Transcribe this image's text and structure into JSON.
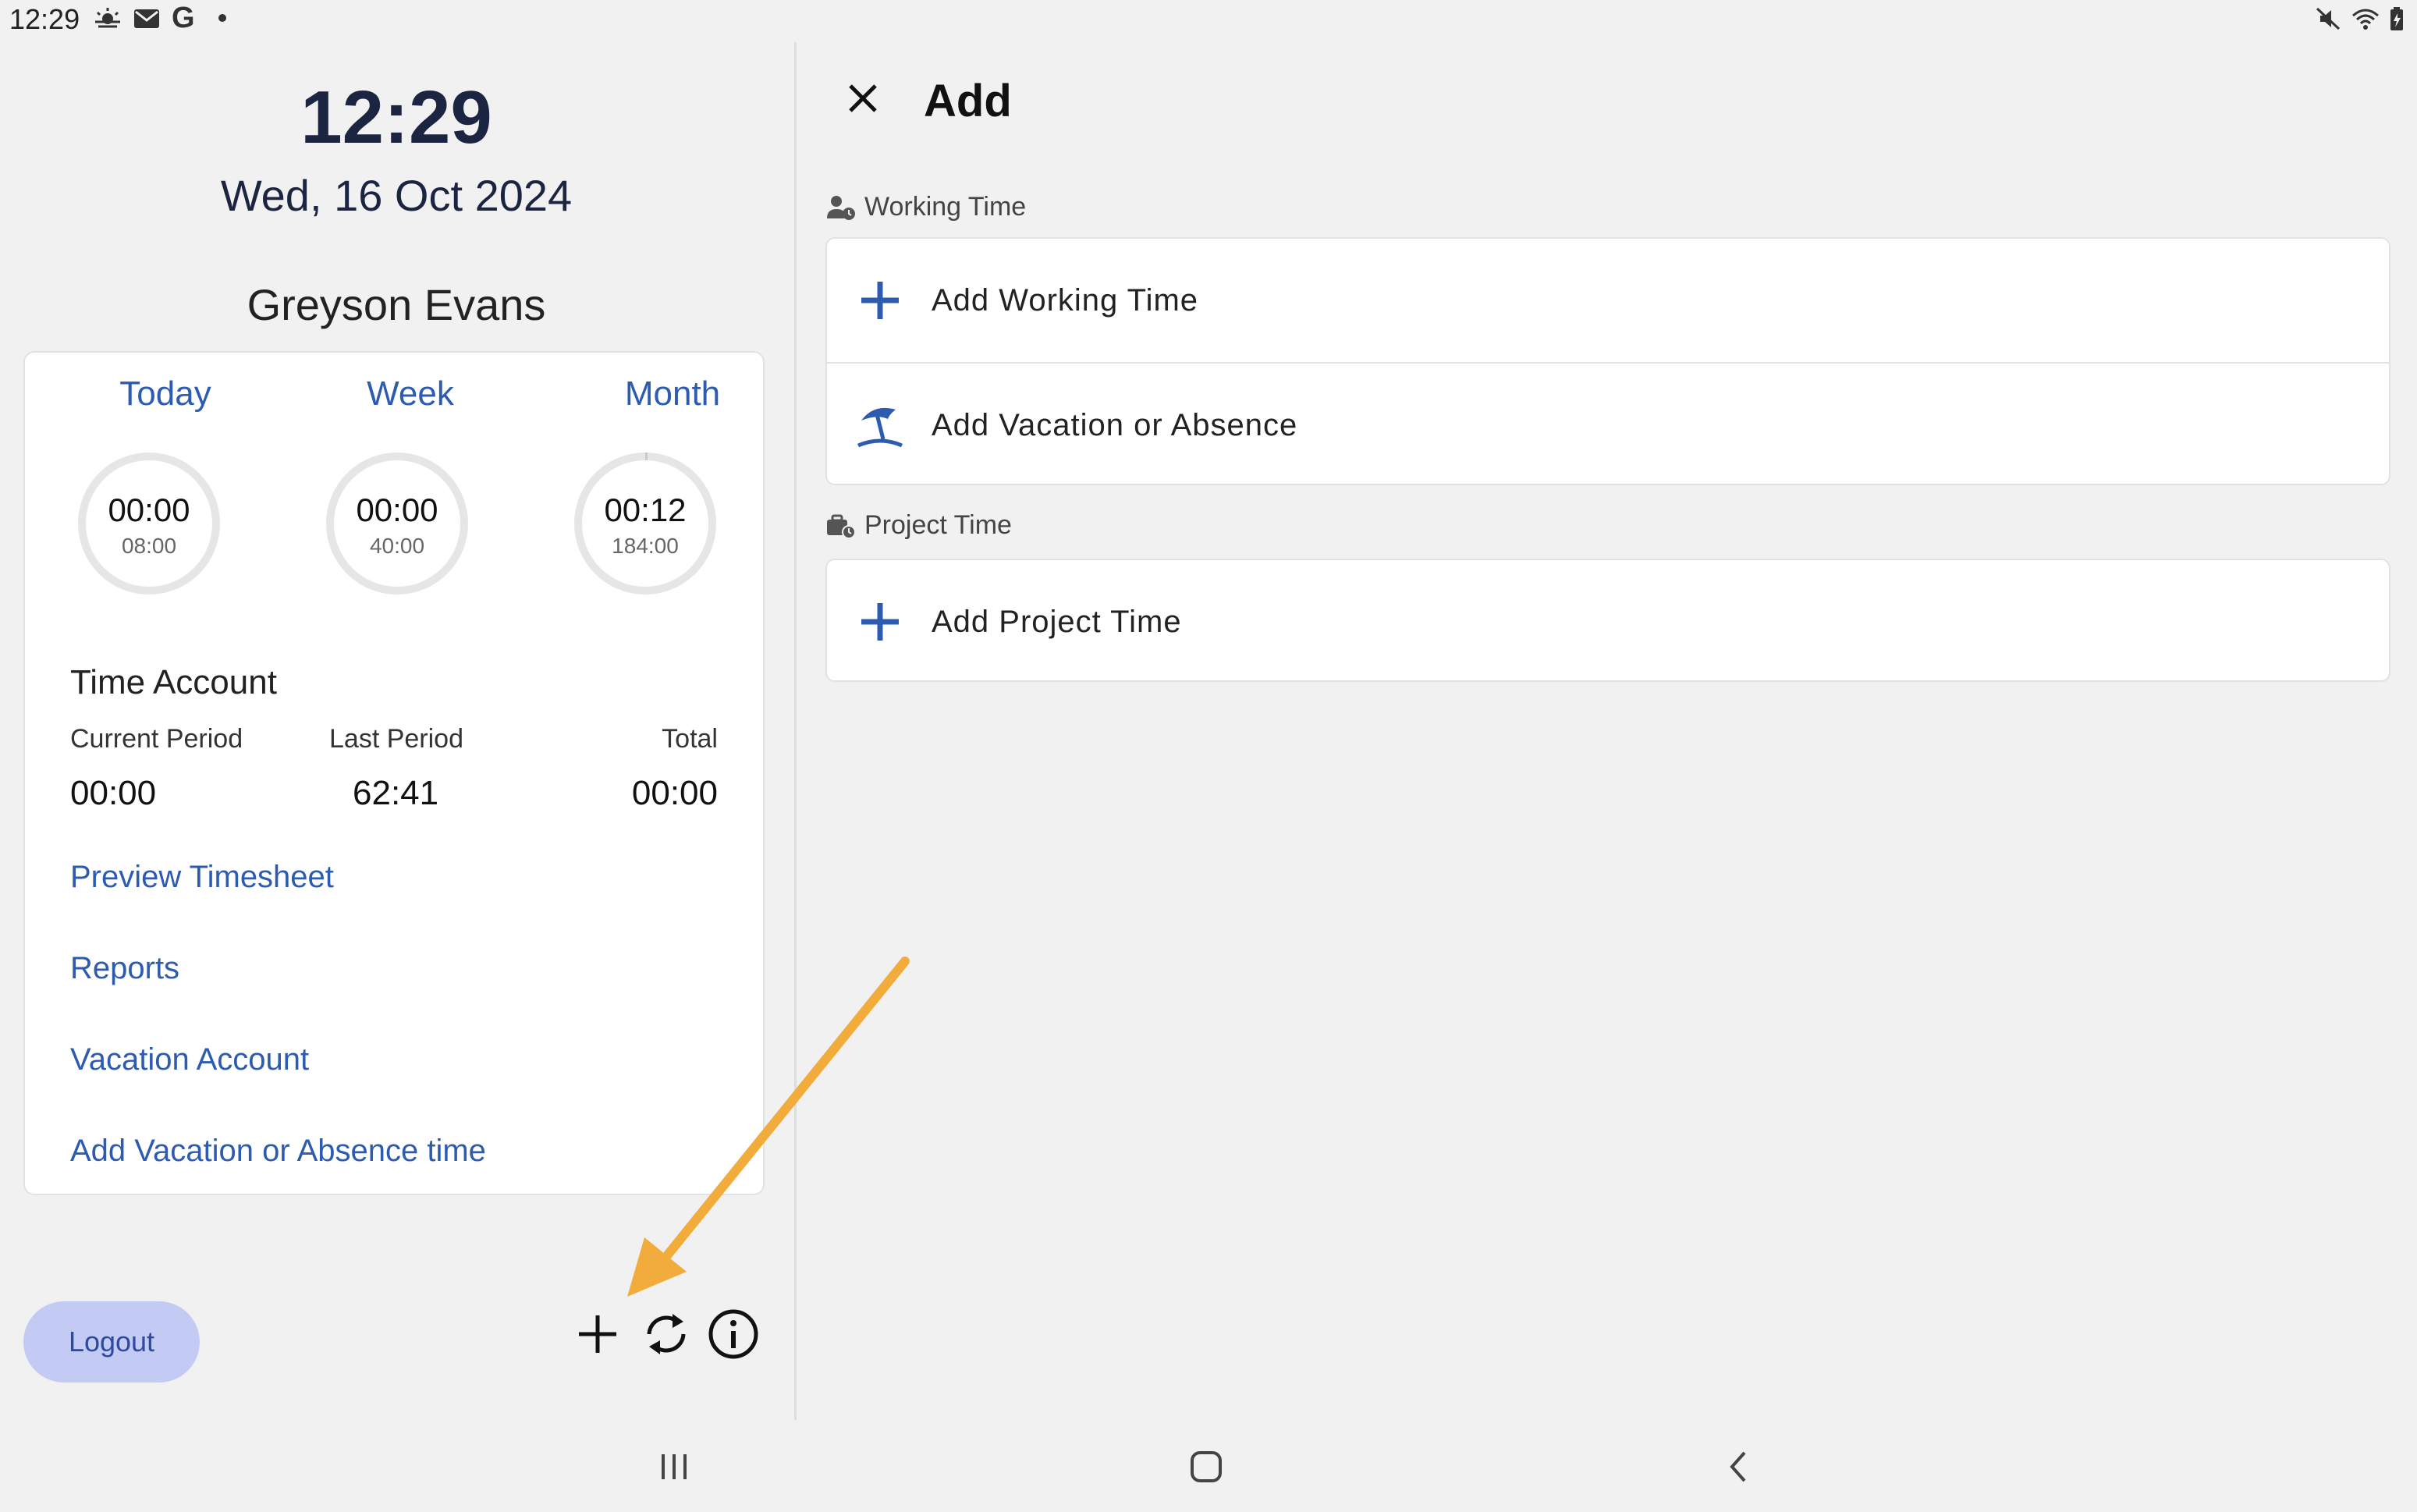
{
  "status_bar": {
    "time": "12:29",
    "icons": [
      "weather-icon",
      "mail-icon",
      "google-icon",
      "notification-dot",
      "mute-icon",
      "wifi-icon",
      "battery-icon"
    ],
    "google_glyph": "G"
  },
  "left": {
    "clock": "12:29",
    "date": "Wed, 16 Oct 2024",
    "user_name": "Greyson Evans",
    "periods": [
      {
        "label": "Today",
        "value": "00:00",
        "target": "08:00",
        "progress": 0.0
      },
      {
        "label": "Week",
        "value": "00:00",
        "target": "40:00",
        "progress": 0.0
      },
      {
        "label": "Month",
        "value": "00:12",
        "target": "184:00",
        "progress": 0.001
      }
    ],
    "time_account": {
      "title": "Time Account",
      "columns": [
        {
          "label": "Current Period",
          "value": "00:00"
        },
        {
          "label": "Last Period",
          "value": "62:41"
        },
        {
          "label": "Total",
          "value": "00:00"
        }
      ]
    },
    "links": [
      "Preview Timesheet",
      "Reports",
      "Vacation Account",
      "Add Vacation or Absence time"
    ],
    "logout_label": "Logout",
    "bottom_icons": [
      "plus-icon",
      "sync-icon",
      "info-icon"
    ]
  },
  "right": {
    "title": "Add",
    "sections": [
      {
        "header": "Working Time",
        "icon": "person-clock-icon",
        "items": [
          {
            "label": "Add Working Time",
            "icon": "plus-icon"
          },
          {
            "label": "Add Vacation or Absence",
            "icon": "beach-umbrella-icon"
          }
        ]
      },
      {
        "header": "Project Time",
        "icon": "briefcase-clock-icon",
        "items": [
          {
            "label": "Add Project Time",
            "icon": "plus-icon"
          }
        ]
      }
    ]
  },
  "colors": {
    "accent_blue": "#2d5bb0",
    "logout_bg": "#c3cbf5",
    "arrow_annotation": "#f2ac3c",
    "background": "#f1f1f1"
  },
  "nav_bar": [
    "recent-apps-icon",
    "home-icon",
    "back-icon"
  ]
}
